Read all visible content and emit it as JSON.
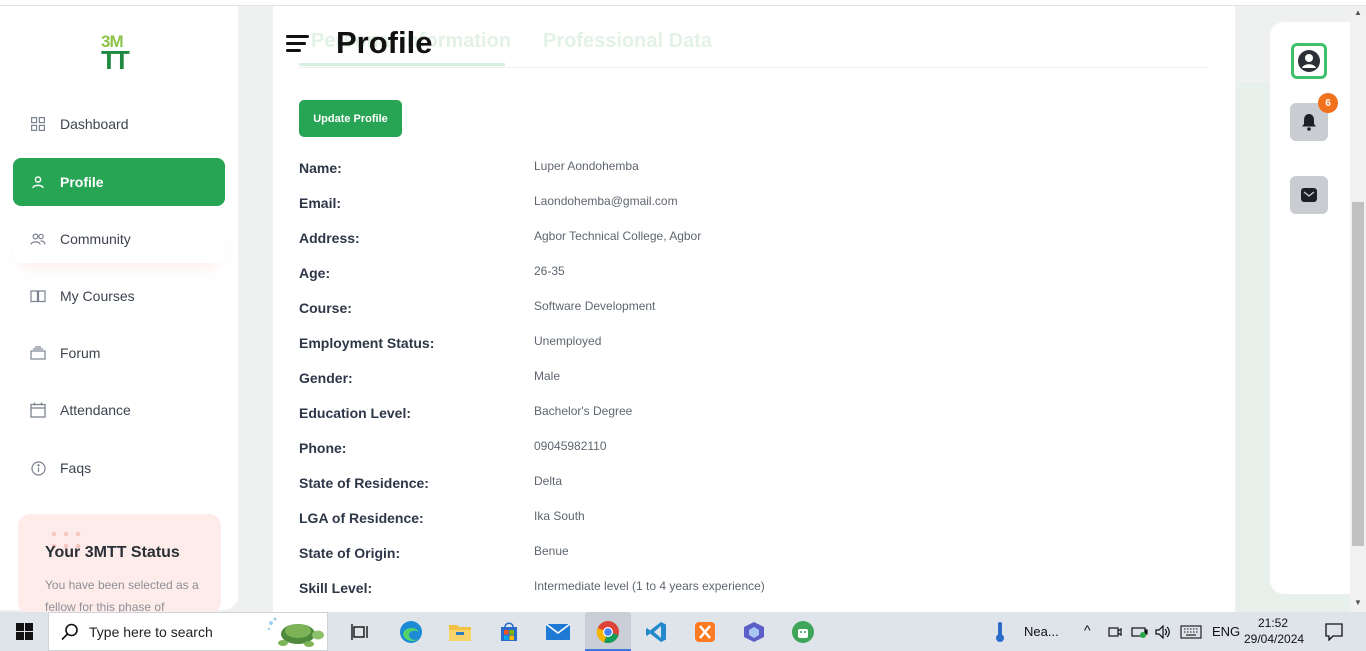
{
  "sidebar": {
    "logo": {
      "line1": "3M",
      "line2": "TT"
    },
    "items": [
      {
        "label": "Dashboard",
        "icon": "grid-icon"
      },
      {
        "label": "Profile",
        "icon": "user-icon"
      },
      {
        "label": "Community",
        "icon": "users-icon"
      },
      {
        "label": "My Courses",
        "icon": "book-icon"
      },
      {
        "label": "Forum",
        "icon": "layers-icon"
      },
      {
        "label": "Attendance",
        "icon": "calendar-icon"
      },
      {
        "label": "Faqs",
        "icon": "info-icon"
      }
    ],
    "status_card": {
      "title": "Your 3MTT Status",
      "text": "You have been selected as a fellow for this phase of"
    }
  },
  "header": {
    "title": "Profile",
    "tabs": [
      "Personal Information",
      "Professional Data"
    ]
  },
  "main": {
    "update_button": "Update Profile",
    "fields": [
      {
        "label": "Name:",
        "value": "Luper Aondohemba"
      },
      {
        "label": "Email:",
        "value": "Laondohemba@gmail.com"
      },
      {
        "label": "Address:",
        "value": "Agbor Technical College, Agbor"
      },
      {
        "label": "Age:",
        "value": "26-35"
      },
      {
        "label": "Course:",
        "value": "Software Development"
      },
      {
        "label": "Employment Status:",
        "value": "Unemployed"
      },
      {
        "label": "Gender:",
        "value": "Male"
      },
      {
        "label": "Education Level:",
        "value": "Bachelor's Degree"
      },
      {
        "label": "Phone:",
        "value": "09045982110"
      },
      {
        "label": "State of Residence:",
        "value": "Delta"
      },
      {
        "label": "LGA of Residence:",
        "value": "Ika South"
      },
      {
        "label": "State of Origin:",
        "value": "Benue"
      },
      {
        "label": "Skill Level:",
        "value": "Intermediate level (1 to 4 years experience)"
      }
    ]
  },
  "right_rail": {
    "notification_count": "6"
  },
  "taskbar": {
    "search_placeholder": "Type here to search",
    "weather": "Nea...",
    "language": "ENG",
    "time": "21:52",
    "date": "29/04/2024"
  },
  "colors": {
    "accent": "#27a454",
    "badge": "#f2711c"
  }
}
